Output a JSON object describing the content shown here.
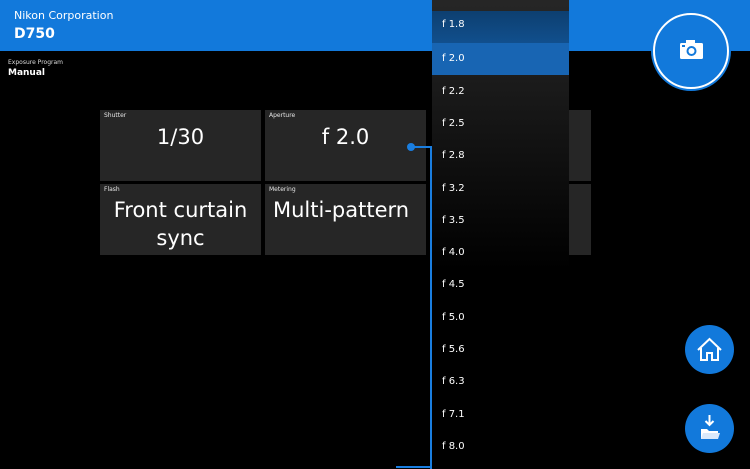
{
  "header": {
    "maker": "Nikon Corporation",
    "model": "D750"
  },
  "exposure_program": {
    "label": "Exposure Program",
    "value": "Manual"
  },
  "tiles": {
    "shutter": {
      "label": "Shutter",
      "value": "1/30"
    },
    "aperture": {
      "label": "Aperture",
      "value": "f 2.0"
    },
    "flash": {
      "label": "Flash",
      "value_line1": "Front curtain",
      "value_line2": "sync"
    },
    "metering": {
      "label": "Metering",
      "value": "Multi-pattern"
    }
  },
  "aperture_dropdown": {
    "options": [
      "f 1.8",
      "f 2.0",
      "f 2.2",
      "f 2.5",
      "f 2.8",
      "f 3.2",
      "f 3.5",
      "f 4.0",
      "f 4.5",
      "f 5.0",
      "f 5.6",
      "f 6.3",
      "f 7.1",
      "f 8.0"
    ],
    "selected": "f 2.0"
  },
  "icons": {
    "capture": "camera-icon",
    "home": "home-icon",
    "download": "download-folder-icon"
  },
  "colors": {
    "accent": "#1279db",
    "selected": "#1865b3",
    "tile": "#262626"
  }
}
